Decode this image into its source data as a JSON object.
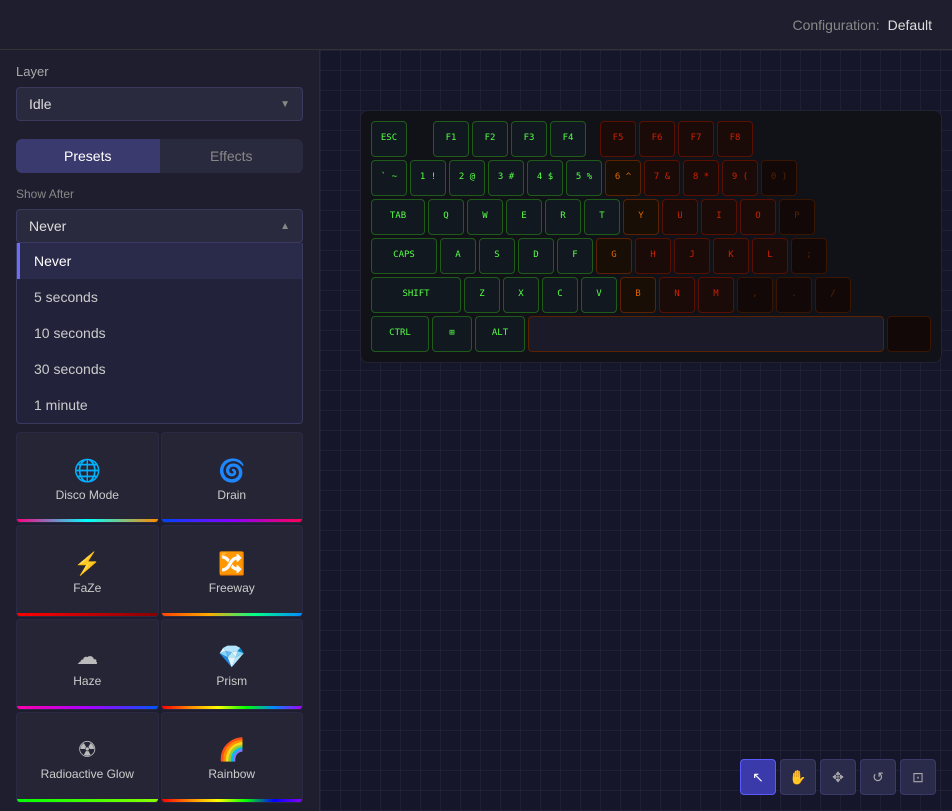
{
  "topbar": {
    "config_label": "Configuration:",
    "config_value": "Default"
  },
  "sidebar": {
    "layer_label": "Layer",
    "layer_value": "Idle",
    "tabs": [
      {
        "id": "presets",
        "label": "Presets",
        "active": true
      },
      {
        "id": "effects",
        "label": "Effects",
        "active": false
      }
    ],
    "show_after_label": "Show After",
    "dropdown_value": "Never",
    "dropdown_items": [
      {
        "label": "Never",
        "selected": true
      },
      {
        "label": "5 seconds",
        "selected": false
      },
      {
        "label": "10 seconds",
        "selected": false
      },
      {
        "label": "30 seconds",
        "selected": false
      },
      {
        "label": "1 minute",
        "selected": false
      }
    ],
    "presets": [
      {
        "id": "disco-mode",
        "name": "Disco Mode",
        "icon": "🌐",
        "bar": "disco"
      },
      {
        "id": "drain",
        "name": "Drain",
        "icon": "🌀",
        "bar": "drain"
      },
      {
        "id": "faze",
        "name": "FaZe",
        "icon": "⚡",
        "bar": "faze"
      },
      {
        "id": "freeway",
        "name": "Freeway",
        "icon": "🔀",
        "bar": "freeway"
      },
      {
        "id": "haze",
        "name": "Haze",
        "icon": "☁",
        "bar": "haze"
      },
      {
        "id": "prism",
        "name": "Prism",
        "icon": "💎",
        "bar": "prism"
      },
      {
        "id": "radioactive-glow",
        "name": "Radioactive Glow",
        "icon": "☢",
        "bar": "rglow"
      },
      {
        "id": "rainbow",
        "name": "Rainbow",
        "icon": "🌈",
        "bar": "rainbow"
      }
    ]
  },
  "keyboard": {
    "rows": [
      [
        "ESC",
        "",
        "F1",
        "F2",
        "F3",
        "F4",
        "",
        "F5",
        "F6",
        "F7",
        "F8"
      ],
      [
        "` ~",
        "1 !",
        "2 @",
        "3 #",
        "4 $",
        "5 %",
        "6 ^",
        "7 &",
        "8 *",
        "9 (",
        "0)"
      ],
      [
        "TAB",
        "Q",
        "W",
        "E",
        "R",
        "T",
        "Y",
        "U",
        "I",
        "O",
        "P"
      ],
      [
        "CAPS",
        "A",
        "S",
        "D",
        "F",
        "G",
        "H",
        "J",
        "K",
        "L",
        ";"
      ],
      [
        "SHIFT",
        "Z",
        "X",
        "C",
        "V",
        "B",
        "N",
        "M",
        ",",
        ".",
        "/"
      ],
      [
        "CTRL",
        "⊞",
        "ALT",
        "",
        "",
        "",
        "",
        "",
        "",
        "",
        ""
      ]
    ]
  },
  "toolbar": {
    "buttons": [
      {
        "id": "select",
        "icon": "↖",
        "active": true
      },
      {
        "id": "pan",
        "icon": "✋",
        "active": false
      },
      {
        "id": "move",
        "icon": "✥",
        "active": false
      },
      {
        "id": "undo",
        "icon": "↺",
        "active": false
      },
      {
        "id": "redo",
        "icon": "⊡",
        "active": false
      }
    ]
  }
}
